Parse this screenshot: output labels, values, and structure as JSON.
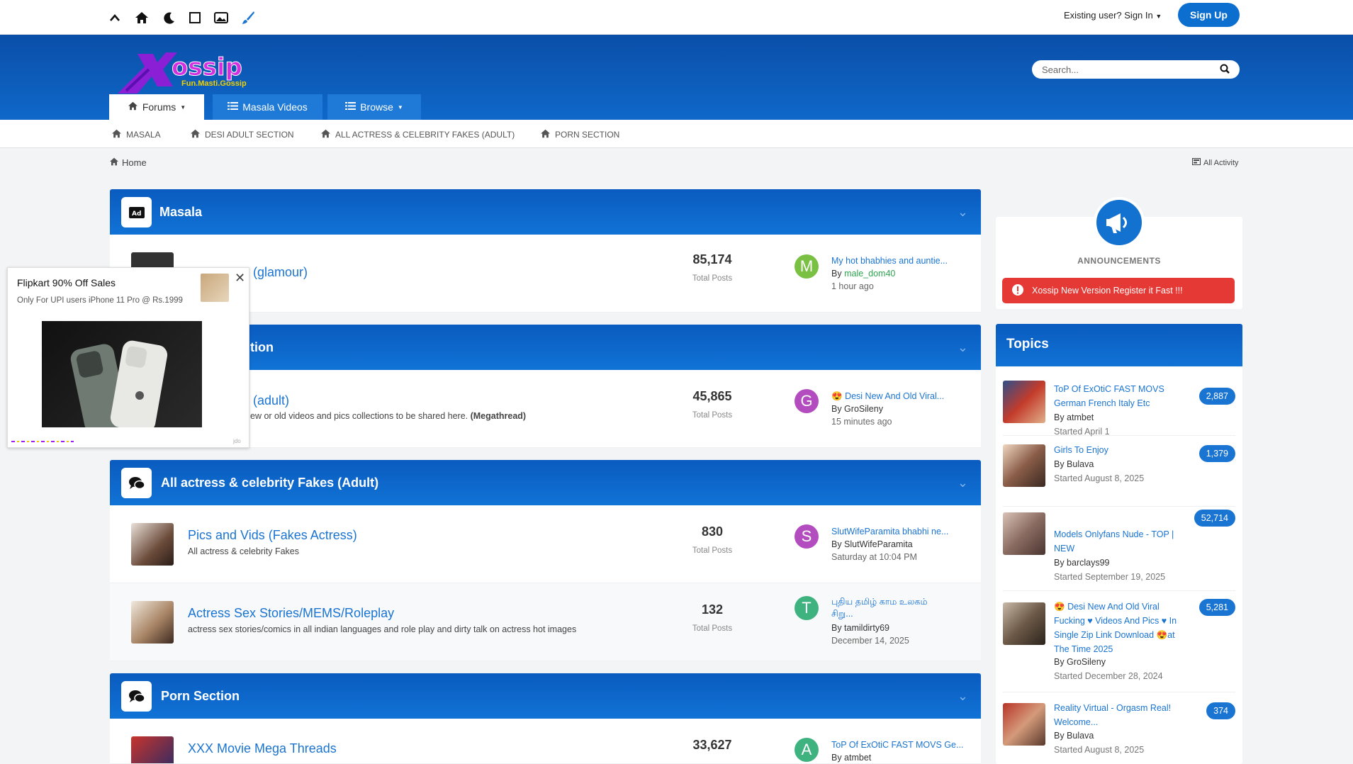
{
  "topbar": {
    "existing_user": "Existing user? Sign In",
    "signup": "Sign Up"
  },
  "header": {
    "logo_tagline": "Fun.Masti.Gossip",
    "search_placeholder": "Search..."
  },
  "nav": {
    "tabs": [
      {
        "label": "Forums"
      },
      {
        "label": "Masala Videos"
      },
      {
        "label": "Browse"
      }
    ]
  },
  "subnav": [
    "Masala",
    "Desi Adult Section",
    "All Actress & Celebrity Fakes (Adult)",
    "Porn Section"
  ],
  "breadcrumb": {
    "home": "Home",
    "all_activity": "All Activity"
  },
  "categories": [
    {
      "name": "Masala"
    },
    {
      "name": "tion"
    },
    {
      "name": "All actress & celebrity Fakes (Adult)"
    },
    {
      "name": "Porn Section"
    }
  ],
  "forums": [
    {
      "title": "(glamour)",
      "desc": "",
      "count": "85,174",
      "count_label": "Total Posts",
      "avatar": "M",
      "last_title": "My hot bhabhies and auntie...",
      "last_by_prefix": "By",
      "last_by": "male_dom40",
      "last_date": "1 hour ago"
    },
    {
      "title": "(adult)",
      "desc": "ew or old videos and pics collections to be shared here.",
      "desc_bold": "(Megathread)",
      "count": "45,865",
      "count_label": "Total Posts",
      "avatar": "G",
      "last_title": "Desi New And Old Viral...",
      "last_by": "By GroSileny",
      "last_date": "15 minutes ago"
    },
    {
      "title": "Pics and Vids (Fakes Actress)",
      "desc": "All actress & celebrity Fakes",
      "count": "830",
      "count_label": "Total Posts",
      "avatar": "S",
      "last_title": "SlutWifeParamita bhabhi ne...",
      "last_by": "By SlutWifeParamita",
      "last_date": "Saturday at 10:04 PM"
    },
    {
      "title": "Actress Sex Stories/MEMS/Roleplay",
      "desc": "actress sex stories/comics in all indian languages and role play and dirty talk on actress hot images",
      "count": "132",
      "count_label": "Total Posts",
      "avatar": "T",
      "last_title": "புதிய தமிழ் காம உலகம்",
      "last_title2": "சிறு...",
      "last_by": "By tamildirty69",
      "last_date": "December 14, 2025"
    },
    {
      "title": "XXX Movie Mega Threads",
      "desc": "",
      "count": "33,627",
      "count_label": "Total Posts",
      "avatar": "A",
      "last_title": "ToP Of ExOtiC FAST MOVS Ge...",
      "last_by": "By atmbet",
      "last_date": ""
    }
  ],
  "announcements": {
    "label": "ANNOUNCEMENTS",
    "item": "Xossip New Version Register it Fast !!!"
  },
  "topics": {
    "title": "Topics",
    "items": [
      {
        "l1": "ToP Of ExOtiC FAST MOVS",
        "l2": "German French Italy Etc",
        "by": "By atmbet",
        "started": "Started April 1",
        "count": "2,887"
      },
      {
        "l1": "Girls To Enjoy",
        "by": "By Bulava",
        "started": "Started August 8, 2025",
        "count": "1,379"
      },
      {
        "l1": "Models Onlyfans Nude - TOP |",
        "l2": "NEW",
        "by": "By barclays99",
        "started": "Started September 19, 2025",
        "count": "52,714"
      },
      {
        "l1": "Desi New And Old Viral",
        "l2": "Fucking ♥ Videos And Pics ♥ In",
        "l3": "Single Zip Link Download",
        "l3b": "at",
        "l4": "The Time 2025",
        "by": "By GroSileny",
        "started": "Started December 28, 2024",
        "count": "5,281"
      },
      {
        "l1": "Reality Virtual - Orgasm Real!",
        "l2": "Welcome...",
        "by": "By Bulava",
        "started": "Started August 8, 2025",
        "count": "374"
      }
    ]
  },
  "ad": {
    "title": "Flipkart 90% Off Sales",
    "subtitle": "Only For UPI users iPhone 11 Pro @ Rs.1999",
    "brand": "jdo"
  },
  "colors": {
    "primary": "#0c6fcf",
    "header": "#0a4fa8",
    "link": "#1a74d2",
    "danger": "#e53935"
  }
}
